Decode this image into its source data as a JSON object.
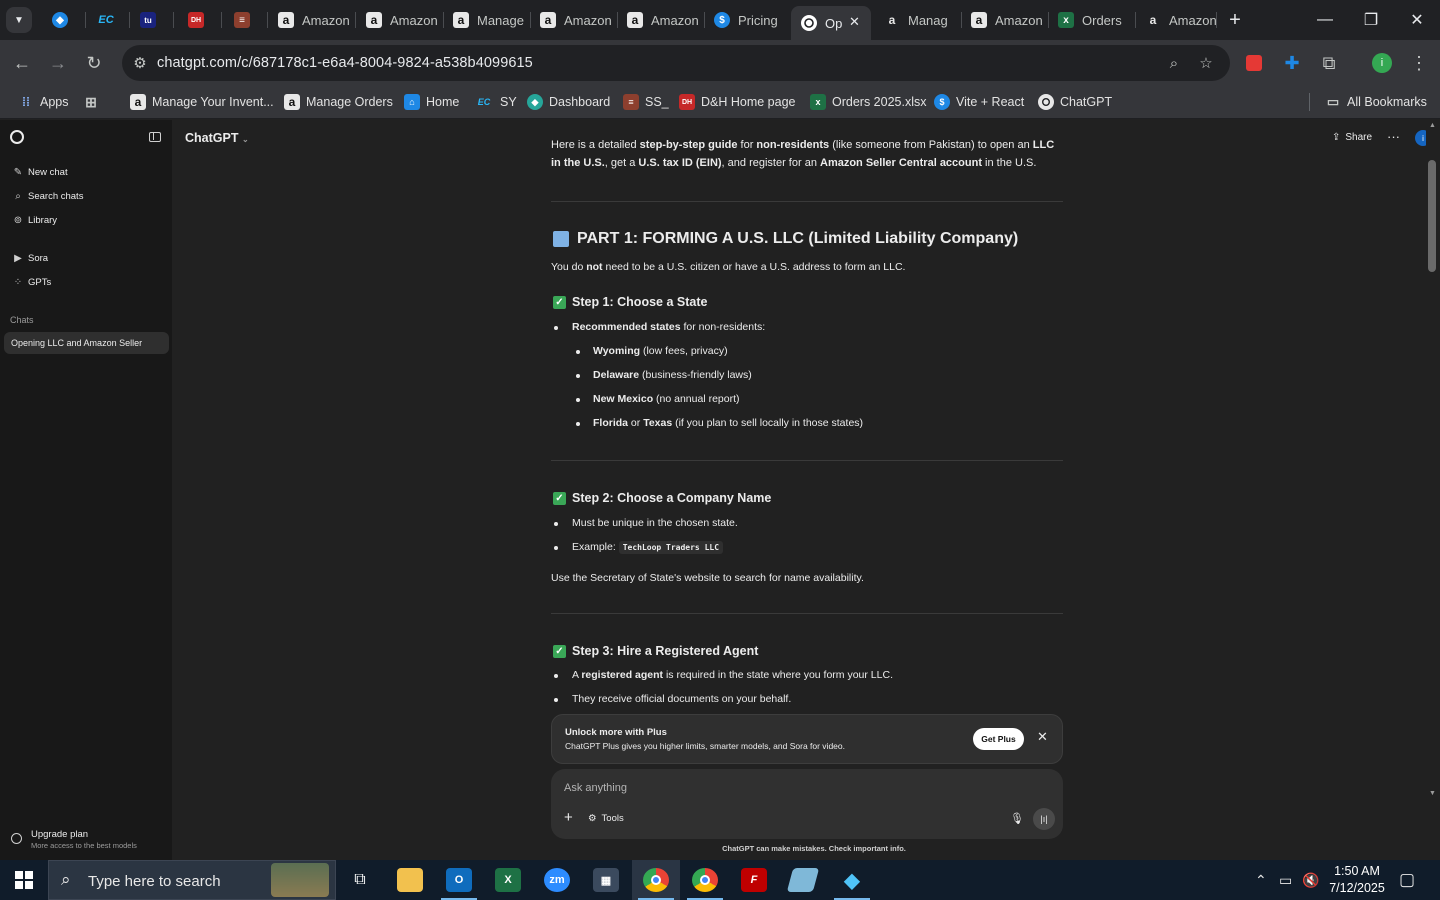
{
  "browser": {
    "tabs": [
      {
        "label": "",
        "icon": "teal-diamond-icon"
      },
      {
        "label": "",
        "icon": "ec-icon"
      },
      {
        "label": "",
        "icon": "tu-icon"
      },
      {
        "label": "",
        "icon": "dh-icon"
      },
      {
        "label": "",
        "icon": "stack-icon"
      },
      {
        "label": "Amazon",
        "icon": "amazon-icon"
      },
      {
        "label": "Amazon",
        "icon": "amazon-icon"
      },
      {
        "label": "Manage",
        "icon": "amazon-icon"
      },
      {
        "label": "Amazon",
        "icon": "amazon-icon"
      },
      {
        "label": "Amazon",
        "icon": "amazon-icon"
      },
      {
        "label": "Pricing",
        "icon": "dollar-icon"
      },
      {
        "label": "Op",
        "icon": "chatgpt-icon"
      },
      {
        "label": "Manag",
        "icon": "amazon-icon"
      },
      {
        "label": "Amazon",
        "icon": "amazon-icon"
      },
      {
        "label": "Orders",
        "icon": "excel-icon"
      },
      {
        "label": "Amazon",
        "icon": "amazon-icon"
      }
    ],
    "url": "chatgpt.com/c/687178c1-e6a4-8004-9824-a538b4099615",
    "bookmarks": [
      {
        "label": "Apps"
      },
      {
        "label": ""
      },
      {
        "label": "Manage Your Invent..."
      },
      {
        "label": "Manage Orders"
      },
      {
        "label": "Home"
      },
      {
        "label": "SY"
      },
      {
        "label": "Dashboard"
      },
      {
        "label": "SS_"
      },
      {
        "label": "D&H Home page"
      },
      {
        "label": "Orders 2025.xlsx"
      },
      {
        "label": "Vite + React"
      },
      {
        "label": "ChatGPT"
      }
    ],
    "all_bookmarks": "All Bookmarks",
    "profile_initial": "i"
  },
  "sidebar": {
    "items": [
      {
        "label": "New chat"
      },
      {
        "label": "Search chats"
      },
      {
        "label": "Library"
      },
      {
        "label": "Sora"
      },
      {
        "label": "GPTs"
      }
    ],
    "section_label": "Chats",
    "active_chat": "Opening LLC and Amazon Seller",
    "upgrade_title": "Upgrade plan",
    "upgrade_sub": "More access to the best models"
  },
  "header": {
    "model": "ChatGPT",
    "share": "Share"
  },
  "message": {
    "intro_pre": "Here is a detailed ",
    "intro_b1": "step-by-step guide",
    "intro_mid1": " for ",
    "intro_b2": "non-residents",
    "intro_mid2": " (like someone from Pakistan) to open an ",
    "intro_b3": "LLC in the U.S.",
    "intro_mid3": ", get a ",
    "intro_b4": "U.S. tax ID (EIN)",
    "intro_mid4": ", and register for an ",
    "intro_b5": "Amazon Seller Central account",
    "intro_end": " in the U.S.",
    "part1_title": "PART 1: FORMING A U.S. LLC (Limited Liability Company)",
    "part1_sub_pre": "You do ",
    "part1_sub_b1": "not",
    "part1_sub_mid": " need to be a U.S. citizen or have a U.S. address to form an LLC.",
    "step1_title": "Step 1: Choose a State",
    "step1_lead_b": "Recommended states",
    "step1_lead_rest": " for non-residents:",
    "states": [
      {
        "name": "Wyoming",
        "note": " (low fees, privacy)"
      },
      {
        "name": "Delaware",
        "note": " (business-friendly laws)"
      },
      {
        "name": "New Mexico",
        "note": " (no annual report)"
      },
      {
        "name": "Florida",
        "note": " or ",
        "name2": "Texas",
        "note2": " (if you plan to sell locally in those states)"
      }
    ],
    "step2_title": "Step 2: Choose a Company Name",
    "step2_b1": "Must be unique in the chosen state.",
    "step2_b2_label": "Example: ",
    "step2_b2_code": "TechLoop Traders LLC",
    "step2_note": "Use the Secretary of State's website to search for name availability.",
    "step3_title": "Step 3: Hire a Registered Agent",
    "step3_b1_pre": "A ",
    "step3_b1_b": "registered agent",
    "step3_b1_rest": " is required in the state where you form your LLC.",
    "step3_b2": "They receive official documents on your behalf."
  },
  "promo": {
    "title": "Unlock more with Plus",
    "subtitle": "ChatGPT Plus gives you higher limits, smarter models, and Sora for video.",
    "button": "Get Plus"
  },
  "composer": {
    "placeholder": "Ask anything",
    "tools": "Tools",
    "disclaimer": "ChatGPT can make mistakes. Check important info."
  },
  "taskbar": {
    "search_placeholder": "Type here to search",
    "time": "1:50 AM",
    "date": "7/12/2025"
  }
}
